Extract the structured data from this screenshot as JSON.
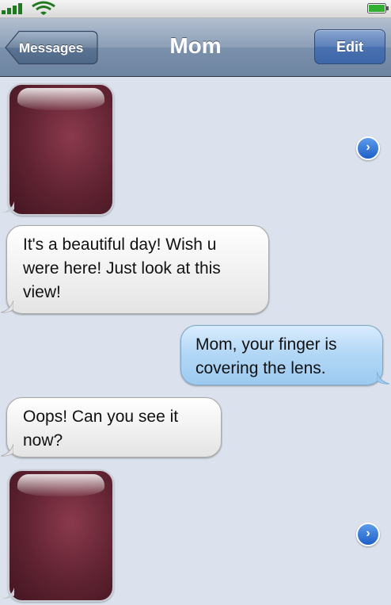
{
  "status_bar": {
    "signal_icon": "signal-bars-icon",
    "wifi_icon": "wifi-icon",
    "battery_icon": "battery-icon"
  },
  "nav": {
    "back_label": "Messages",
    "title": "Mom",
    "edit_label": "Edit"
  },
  "messages": [
    {
      "type": "photo",
      "direction": "incoming"
    },
    {
      "type": "text",
      "direction": "incoming",
      "lines": [
        "It's a beautiful day! Wish u",
        "were here! Just look at this",
        "view!"
      ]
    },
    {
      "type": "text",
      "direction": "outgoing",
      "lines": [
        "Mom, your finger is",
        "covering the lens."
      ]
    },
    {
      "type": "text",
      "direction": "incoming",
      "lines": [
        "Oops! Can you see it",
        "now?"
      ]
    },
    {
      "type": "photo",
      "direction": "incoming"
    }
  ],
  "disclosure_glyph": "›",
  "colors": {
    "nav_bar": "#8c9fb7",
    "background": "#dbe2ed",
    "incoming_bubble": "#f3f3f3",
    "outgoing_bubble": "#b4d8f6",
    "photo": "#5f2231",
    "disclosure": "#1d5fc9"
  }
}
